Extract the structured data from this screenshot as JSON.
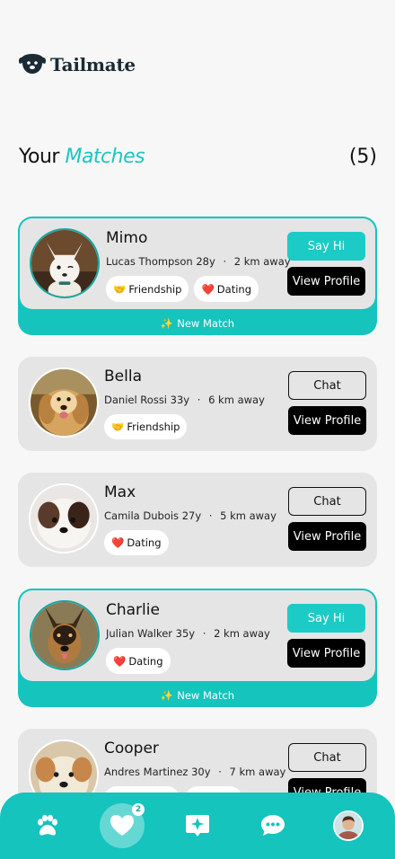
{
  "app": {
    "name": "Tailmate"
  },
  "header": {
    "title_plain": "Your",
    "title_accent": "Matches",
    "count": "(5)"
  },
  "colors": {
    "accent": "#1cc6c2",
    "card_bg": "#e5e5e5",
    "button_dark": "#000000"
  },
  "matches": [
    {
      "pet": "Mimo",
      "owner": "Lucas Thompson 28y",
      "distance": "2 km away",
      "tags": [
        {
          "emoji": "🤝",
          "label": "Friendship"
        },
        {
          "emoji": "❤️",
          "label": "Dating"
        }
      ],
      "primary": "Say Hi",
      "secondary": "View Profile",
      "new_label": "New Match",
      "new_icon": "✨",
      "is_new": true
    },
    {
      "pet": "Bella",
      "owner": "Daniel Rossi 33y",
      "distance": "6 km away",
      "tags": [
        {
          "emoji": "🤝",
          "label": "Friendship"
        }
      ],
      "primary": "Chat",
      "secondary": "View Profile",
      "is_new": false
    },
    {
      "pet": "Max",
      "owner": "Camila Dubois 27y",
      "distance": "5 km away",
      "tags": [
        {
          "emoji": "❤️",
          "label": "Dating"
        }
      ],
      "primary": "Chat",
      "secondary": "View Profile",
      "is_new": false
    },
    {
      "pet": "Charlie",
      "owner": "Julian Walker 35y",
      "distance": "2 km away",
      "tags": [
        {
          "emoji": "❤️",
          "label": "Dating"
        }
      ],
      "primary": "Say Hi",
      "secondary": "View Profile",
      "new_label": "New Match",
      "new_icon": "✨",
      "is_new": true
    },
    {
      "pet": "Cooper",
      "owner": "Andres Martinez 30y",
      "distance": "7 km away",
      "tags": [
        {
          "emoji": "",
          "label": ""
        },
        {
          "emoji": "",
          "label": ""
        }
      ],
      "primary": "Chat",
      "secondary": "View Profile",
      "is_new": false
    }
  ],
  "separator": "·",
  "nav": {
    "items": [
      {
        "icon": "paw-icon"
      },
      {
        "icon": "heart-icon",
        "badge": "2",
        "active": true
      },
      {
        "icon": "sparkle-chat-icon"
      },
      {
        "icon": "chat-bubble-icon"
      },
      {
        "icon": "profile-avatar"
      }
    ]
  }
}
